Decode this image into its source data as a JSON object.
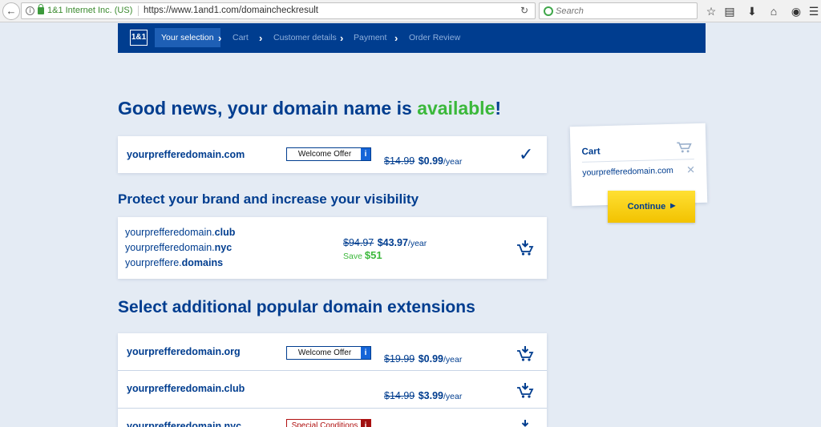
{
  "browser": {
    "org": "1&1 Internet Inc. (US)",
    "url": "https://www.1and1.com/domaincheckresult",
    "search_placeholder": "Search"
  },
  "nav": {
    "logo": "1&1",
    "steps": [
      "Your selection",
      "Cart",
      "Customer details",
      "Payment",
      "Order Review"
    ]
  },
  "headline": {
    "prefix": "Good news, your domain name is ",
    "highlight": "available",
    "suffix": "!"
  },
  "primary": {
    "domain": "yourprefferedomain.com",
    "badge": "Welcome Offer",
    "old_price": "$14.99",
    "new_price": "$0.99",
    "per": "/year"
  },
  "protect": {
    "heading": "Protect your brand and increase your visibility",
    "domains": [
      {
        "base": "yourprefferedomain.",
        "tld": "club"
      },
      {
        "base": "yourprefferedomain.",
        "tld": "nyc"
      },
      {
        "base": "yourpreffere.",
        "tld": "domains"
      }
    ],
    "old_price": "$94.97",
    "new_price": "$43.97",
    "per": "/year",
    "save_label": "Save",
    "save_amount": "$51"
  },
  "additional": {
    "heading": "Select additional popular domain extensions",
    "rows": [
      {
        "domain": "yourprefferedomain.org",
        "badge": "Welcome Offer",
        "old_price": "$19.99",
        "new_price": "$0.99",
        "per": "/year"
      },
      {
        "domain": "yourprefferedomain.club",
        "badge": "",
        "old_price": "$14.99",
        "new_price": "$3.99",
        "per": "/year"
      },
      {
        "domain": "yourprefferedomain.nyc",
        "badge": "Special Conditions",
        "old_price": "",
        "new_price": "",
        "per": ""
      }
    ]
  },
  "cart": {
    "title": "Cart",
    "item": "yourprefferedomain.com",
    "continue": "Continue"
  },
  "colors": {
    "brand_blue": "#003d8f",
    "available_green": "#3bb83b",
    "continue_yellow": "#f5c800",
    "page_bg": "#e4ebf4"
  }
}
